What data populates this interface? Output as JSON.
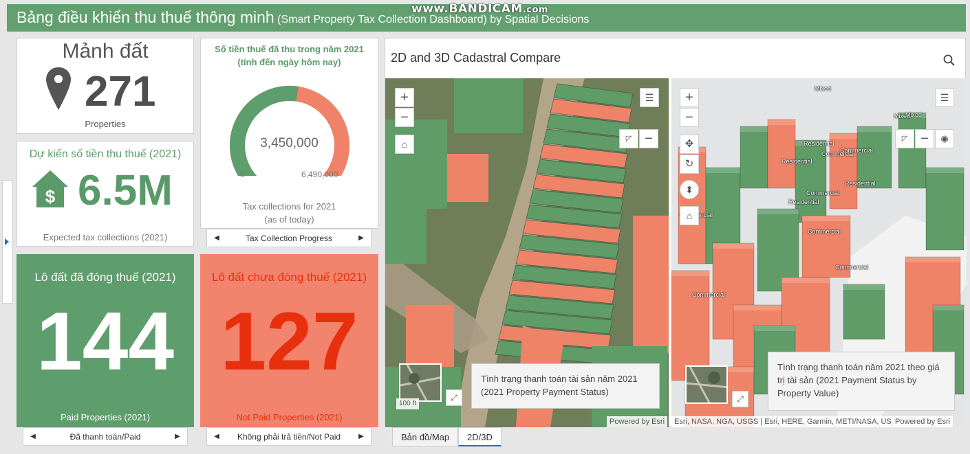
{
  "header": {
    "title": "Bảng điều khiển thu thuế thông minh",
    "subtitle": "(Smart Property Tax Collection Dashboard) by Spatial Decisions",
    "watermark_main": "www.BANDICAM",
    "watermark_suffix": ".com"
  },
  "parcels_card": {
    "title": "Mảnh đất",
    "value": "271",
    "caption": "Properties",
    "icon": "map-pin-icon"
  },
  "expected_card": {
    "title": "Dự kiến số tiền thu thuế (2021)",
    "value": "6.5M",
    "caption": "Expected tax collections (2021)",
    "icon": "house-dollar-icon"
  },
  "gauge_card": {
    "title_line1": "Số tiền thuế đã thu trong năm 2021",
    "title_line2": "(tính đến ngày hôm nay)",
    "value_label": "3,450,000",
    "value": 3450000,
    "min": 0,
    "max": 6490000,
    "min_label": "0",
    "max_label": "6,490,000",
    "caption_line1": "Tax collections for 2021",
    "caption_line2": "(as of today)",
    "pager_label": "Tax Collection Progress",
    "colors": {
      "filled": "#5e9e6c",
      "remaining": "#f0826a"
    }
  },
  "paid_card": {
    "title": "Lô đất đã đóng thuế (2021)",
    "value": "144",
    "caption": "Paid Properties (2021)",
    "pager_label": "Đã thanh toán/Paid",
    "bg": "#5e9e6c",
    "fg": "#ffffff"
  },
  "unpaid_card": {
    "title": "Lô đất chưa đóng thuế (2021)",
    "value": "127",
    "caption": "Not Paid Properties (2021)",
    "pager_label": "Không phải trả tiền/Not Paid",
    "bg": "#f2836c",
    "fg": "#e8300f"
  },
  "panel": {
    "title": "2D and 3D Cadastral Compare",
    "map2d": {
      "popup": "Tình trạng thanh toán tài sản năm 2021 (2021 Property Payment Status)",
      "attribution": "Powered by Esri",
      "scale": "100 ft"
    },
    "map3d": {
      "popup": "Tình trạng thanh toán năm 2021 theo giá trị tài sản (2021 Payment Status by Property Value)",
      "attribution_sources": "Esri, NASA, NGA, USGS | Esri, HERE, Garmin, METI/NASA, US...",
      "attribution_powered": "Powered by Esri",
      "labels": [
        "Mixed",
        "Residential",
        "Commercial",
        "Residential",
        "Mixed",
        "Commercial",
        "Residential",
        "Commercial",
        "Residential",
        "Commercial",
        "Commercial",
        "Commercial",
        "Mixed",
        "Commercial"
      ]
    }
  },
  "tabs": [
    {
      "label": "Bản đồ/Map",
      "active": false
    },
    {
      "label": "2D/3D",
      "active": true
    }
  ],
  "colors": {
    "green": "#62a070",
    "salmon": "#f2836c",
    "red_text": "#e8300f"
  }
}
